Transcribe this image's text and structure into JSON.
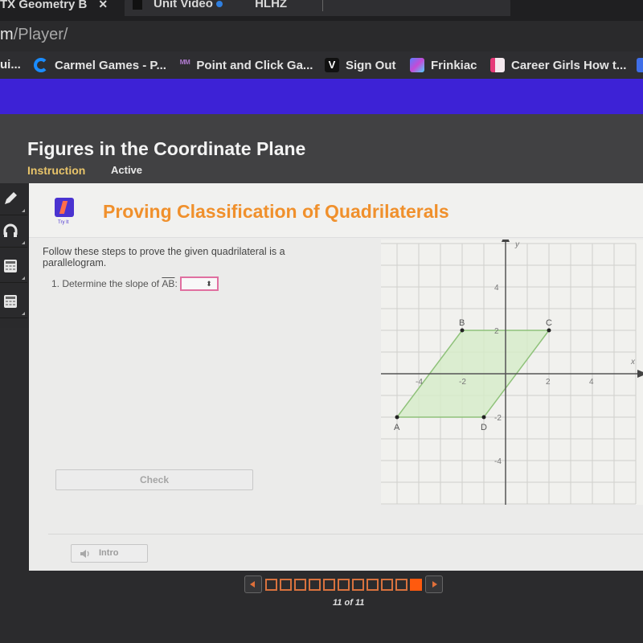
{
  "browser": {
    "tabs": [
      {
        "label": "TX Geometry B",
        "active": true
      },
      {
        "label": "Unit Video",
        "active": false
      },
      {
        "label": "HLHZ",
        "active": false
      }
    ],
    "url_prefix": "m",
    "url_path": "/Player/",
    "bookmarks": [
      {
        "label": "ui...",
        "icon": "blue-circle-icon"
      },
      {
        "label": "Carmel Games - P...",
        "icon": "carmel-c-icon"
      },
      {
        "label": "Point and Click Ga...",
        "icon": "pc-figures-icon"
      },
      {
        "label": "Sign Out",
        "icon": "v-logo-icon"
      },
      {
        "label": "Frinkiac",
        "icon": "frinkiac-grid-icon"
      },
      {
        "label": "Career Girls How t...",
        "icon": "career-girls-icon"
      }
    ]
  },
  "app": {
    "course_title": "Figures in the Coordinate Plane",
    "tabs": [
      {
        "label": "Instruction",
        "selected": true
      },
      {
        "label": "Active",
        "selected": false
      }
    ],
    "tools": [
      {
        "name": "pencil-tool",
        "icon": "pencil-icon"
      },
      {
        "name": "audio-tool",
        "icon": "headphones-icon"
      },
      {
        "name": "calculator-tool",
        "icon": "calculator-icon"
      },
      {
        "name": "reference-tool",
        "icon": "calculator-icon"
      }
    ]
  },
  "lesson": {
    "badge_label": "Try It",
    "title": "Proving Classification of Quadrilaterals",
    "instructions": "Follow these steps to prove the given quadrilateral is a parallelogram.",
    "step_prefix": "1. Determine the slope of",
    "segment": "AB",
    "step_suffix": ":",
    "slope_select_value": "",
    "check_label": "Check",
    "intro_label": "Intro"
  },
  "graph": {
    "x_axis_label": "x",
    "y_axis_label": "y",
    "range": [
      -6,
      6
    ],
    "x_ticks": [
      "-4",
      "-2",
      "2",
      "4"
    ],
    "y_ticks": [
      "4",
      "2",
      "-2",
      "-4"
    ],
    "fill_color": "#d6ecc8",
    "edge_color": "#8fc27a",
    "points": [
      {
        "label": "A",
        "x": -5,
        "y": -2
      },
      {
        "label": "B",
        "x": -2,
        "y": 2
      },
      {
        "label": "C",
        "x": 2,
        "y": 2
      },
      {
        "label": "D",
        "x": -1,
        "y": -2
      }
    ]
  },
  "navigation": {
    "current": 11,
    "total": 11,
    "count_text": "11 of 11",
    "accent": "#ff5a0e"
  }
}
